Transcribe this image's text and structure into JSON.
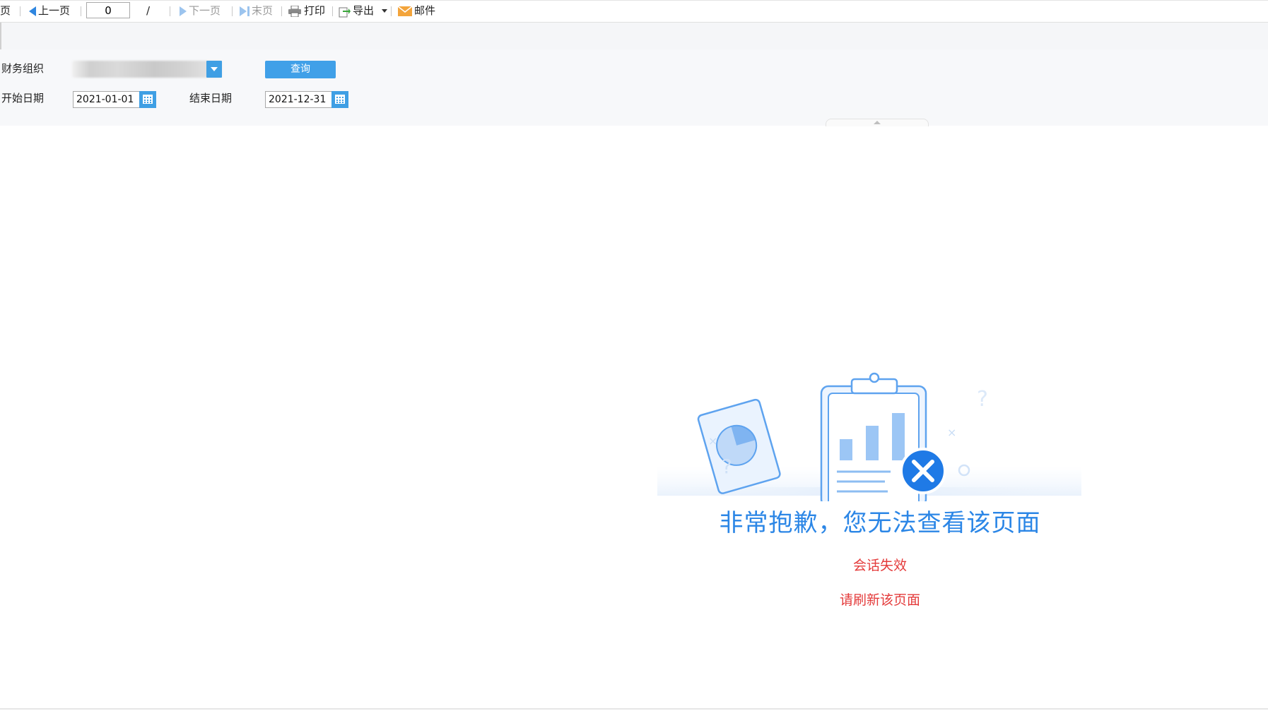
{
  "toolbar": {
    "first_label": "页",
    "prev_label": "上一页",
    "page_value": "0",
    "page_sep": "/",
    "next_label": "下一页",
    "last_label": "末页",
    "print_label": "打印",
    "export_label": "导出",
    "mail_label": "邮件"
  },
  "filters": {
    "org_label": "财务组织",
    "query_label": "查询",
    "start_label": "开始日期",
    "start_value": "2021-01-01",
    "end_label": "结束日期",
    "end_value": "2021-12-31"
  },
  "error": {
    "title": "非常抱歉，您无法查看该页面",
    "message1": "会话失效",
    "message2": "请刷新该页面"
  },
  "colors": {
    "accent": "#40a0e8",
    "error_title": "#2b86e6",
    "error_text": "#e43b3b"
  }
}
